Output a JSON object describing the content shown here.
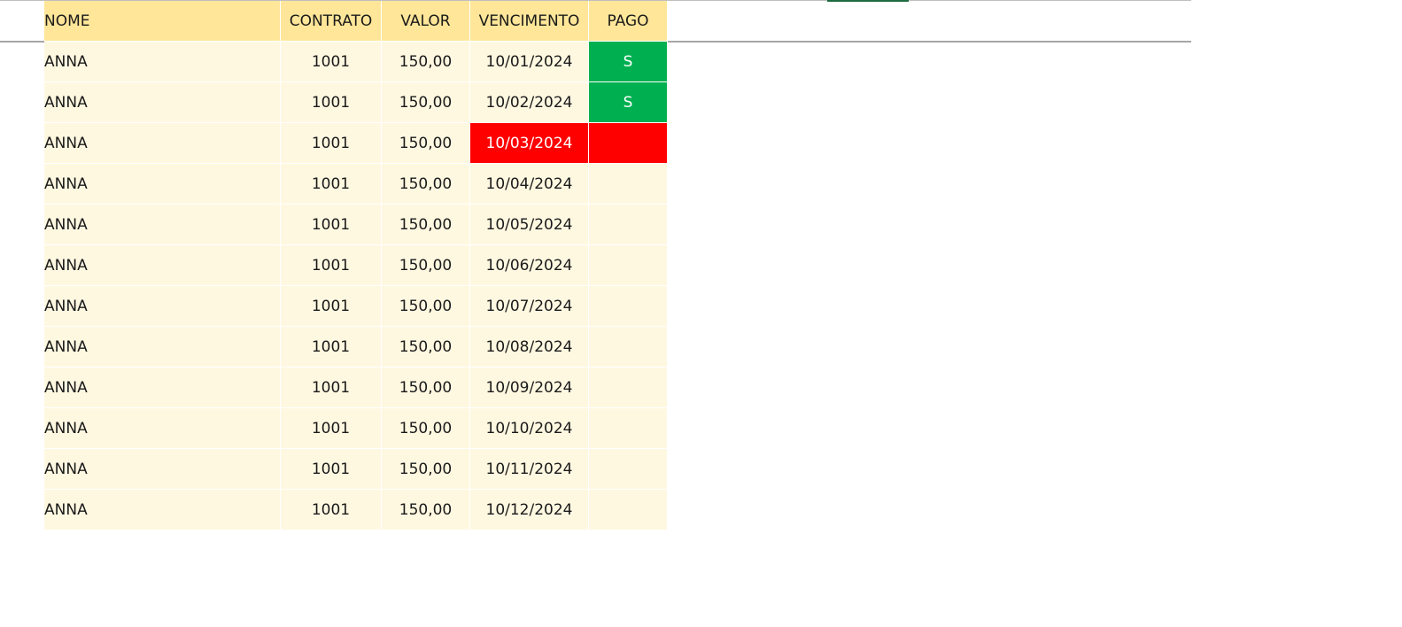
{
  "sheet": {
    "headers": {
      "nome": "NOME",
      "contrato": "CONTRATO",
      "valor": "VALOR",
      "vencimento": "VENCIMENTO",
      "pago": "PAGO"
    },
    "rows": [
      {
        "nome": "ANNA",
        "contrato": "1001",
        "valor": "150,00",
        "vencimento": "10/01/2024",
        "pago": "S",
        "status": "paid"
      },
      {
        "nome": "ANNA",
        "contrato": "1001",
        "valor": "150,00",
        "vencimento": "10/02/2024",
        "pago": "S",
        "status": "paid"
      },
      {
        "nome": "ANNA",
        "contrato": "1001",
        "valor": "150,00",
        "vencimento": "10/03/2024",
        "pago": "",
        "status": "overdue"
      },
      {
        "nome": "ANNA",
        "contrato": "1001",
        "valor": "150,00",
        "vencimento": "10/04/2024",
        "pago": "",
        "status": "open"
      },
      {
        "nome": "ANNA",
        "contrato": "1001",
        "valor": "150,00",
        "vencimento": "10/05/2024",
        "pago": "",
        "status": "open"
      },
      {
        "nome": "ANNA",
        "contrato": "1001",
        "valor": "150,00",
        "vencimento": "10/06/2024",
        "pago": "",
        "status": "open"
      },
      {
        "nome": "ANNA",
        "contrato": "1001",
        "valor": "150,00",
        "vencimento": "10/07/2024",
        "pago": "",
        "status": "open"
      },
      {
        "nome": "ANNA",
        "contrato": "1001",
        "valor": "150,00",
        "vencimento": "10/08/2024",
        "pago": "",
        "status": "open"
      },
      {
        "nome": "ANNA",
        "contrato": "1001",
        "valor": "150,00",
        "vencimento": "10/09/2024",
        "pago": "",
        "status": "open"
      },
      {
        "nome": "ANNA",
        "contrato": "1001",
        "valor": "150,00",
        "vencimento": "10/10/2024",
        "pago": "",
        "status": "open"
      },
      {
        "nome": "ANNA",
        "contrato": "1001",
        "valor": "150,00",
        "vencimento": "10/11/2024",
        "pago": "",
        "status": "open"
      },
      {
        "nome": "ANNA",
        "contrato": "1001",
        "valor": "150,00",
        "vencimento": "10/12/2024",
        "pago": "",
        "status": "open"
      }
    ]
  },
  "colors": {
    "header_fill": "#ffe699",
    "cell_fill": "#fff8e1",
    "paid_fill": "#00b050",
    "overdue_fill": "#ff0000"
  }
}
